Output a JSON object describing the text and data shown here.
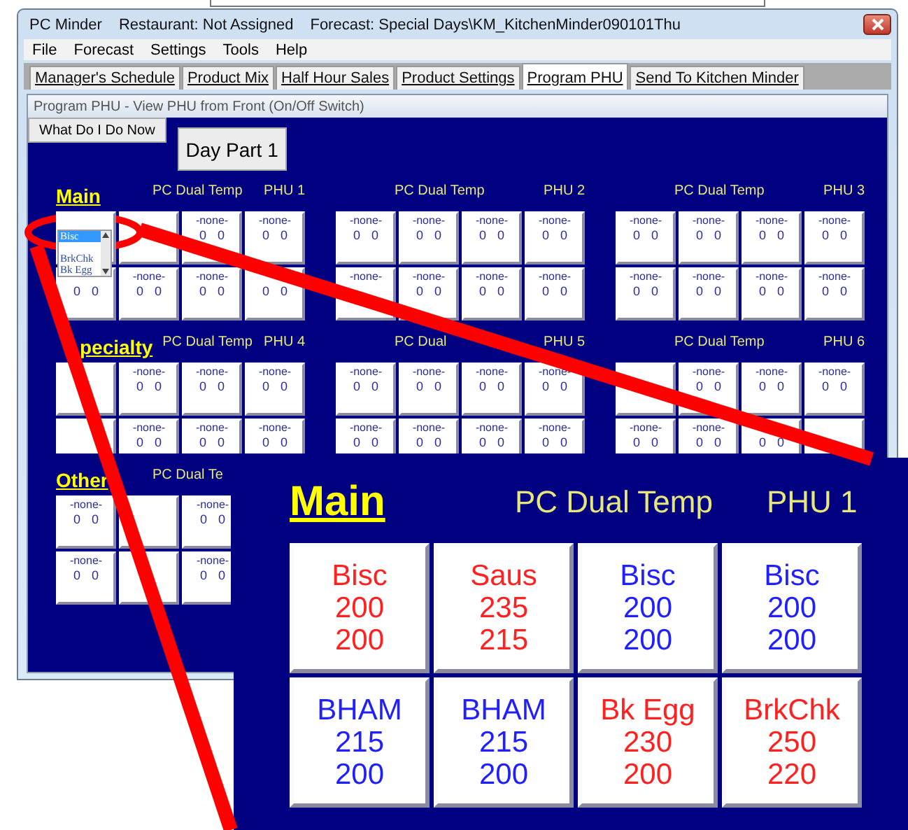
{
  "window": {
    "title_parts": [
      "PC Minder",
      "Restaurant: Not Assigned",
      "Forecast: Special Days\\KM_KitchenMinder090101Thu"
    ]
  },
  "menu": [
    "File",
    "Forecast",
    "Settings",
    "Tools",
    "Help"
  ],
  "tabs": [
    {
      "label": "Manager's Schedule",
      "selected": false
    },
    {
      "label": "Product Mix",
      "selected": false
    },
    {
      "label": "Half Hour Sales",
      "selected": false
    },
    {
      "label": "Product Settings",
      "selected": false
    },
    {
      "label": "Program PHU",
      "selected": true
    },
    {
      "label": "Send To Kitchen Minder",
      "selected": false
    }
  ],
  "panel": {
    "title": "Program PHU - View PHU from Front (On/Off Switch)",
    "help_button": "What Do I Do Now",
    "day_part_button": "Day Part 1"
  },
  "sections": [
    {
      "title": "Main",
      "groups": [
        {
          "model": "PC Dual Temp",
          "phu": "PHU 1",
          "cells": [
            {
              "list": [
                {
                  "label": "Bisc",
                  "selected": true
                },
                {
                  "selected": false
                },
                {
                  "label": "BrkChk",
                  "selected": false
                },
                {
                  "label": "Bk Egg",
                  "selected": false
                }
              ]
            },
            {},
            {
              "name": "-none-",
              "values": [
                "0",
                "0"
              ]
            },
            {
              "name": "-none-",
              "values": [
                "0",
                "0"
              ]
            },
            {
              "values": [
                "0",
                "0"
              ]
            },
            {
              "name": "-none-",
              "values": [
                "0",
                "0"
              ]
            },
            {
              "name": "-none-",
              "values": [
                "0",
                "0"
              ]
            },
            {
              "values": [
                "0",
                "0"
              ]
            }
          ]
        },
        {
          "model": "PC Dual Temp",
          "phu": "PHU 2",
          "cells": [
            {
              "name": "-none-",
              "values": [
                "0",
                "0"
              ]
            },
            {
              "name": "-none-",
              "values": [
                "0",
                "0"
              ]
            },
            {
              "name": "-none-",
              "values": [
                "0",
                "0"
              ]
            },
            {
              "name": "-none-",
              "values": [
                "0",
                "0"
              ]
            },
            {
              "name": "-none-"
            },
            {
              "name": "-none-",
              "values": [
                "0",
                "0"
              ]
            },
            {
              "name": "-none-",
              "values": [
                "0",
                "0"
              ]
            },
            {
              "name": "-none-",
              "values": [
                "0",
                "0"
              ]
            }
          ]
        },
        {
          "model": "PC Dual Temp",
          "phu": "PHU 3",
          "cells": [
            {
              "name": "-none-",
              "values": [
                "0",
                "0"
              ]
            },
            {
              "name": "-none-",
              "values": [
                "0",
                "0"
              ]
            },
            {
              "name": "-none-",
              "values": [
                "0",
                "0"
              ]
            },
            {
              "name": "-none-",
              "values": [
                "0",
                "0"
              ]
            },
            {
              "name": "-none-",
              "values": [
                "0",
                "0"
              ]
            },
            {
              "name": "-none-",
              "values": [
                "0",
                "0"
              ]
            },
            {
              "name": "-none-",
              "values": [
                "0",
                "0"
              ]
            },
            {
              "name": "-none-",
              "values": [
                "0",
                "0"
              ]
            }
          ]
        }
      ]
    },
    {
      "title": "pecialty",
      "groups": [
        {
          "model": "PC Dual Temp",
          "phu": "PHU 4",
          "cells": [
            {},
            {
              "name": "-none-",
              "values": [
                "0",
                "0"
              ]
            },
            {
              "name": "-none-",
              "values": [
                "0",
                "0"
              ]
            },
            {
              "name": "-none-",
              "values": [
                "0",
                "0"
              ]
            },
            {},
            {
              "name": "-none-",
              "values": [
                "0",
                "0"
              ]
            },
            {
              "name": "-none-",
              "values": [
                "0",
                "0"
              ]
            },
            {
              "name": "-none-",
              "values": [
                "0",
                "0"
              ]
            }
          ]
        },
        {
          "model": "PC Dual",
          "phu": "PHU 5",
          "cells": [
            {
              "name": "-none-",
              "values": [
                "0",
                "0"
              ]
            },
            {
              "name": "-none-",
              "values": [
                "0",
                "0"
              ]
            },
            {
              "name": "-none-",
              "values": [
                "0",
                "0"
              ]
            },
            {
              "name": "-none-",
              "values": [
                "0",
                "0"
              ]
            },
            {
              "name": "-none-",
              "values": [
                "0",
                "0"
              ]
            },
            {
              "name": "-none-",
              "values": [
                "0",
                "0"
              ]
            },
            {
              "name": "-none-",
              "values": [
                "0",
                "0"
              ]
            },
            {
              "name": "-none-",
              "values": [
                "0",
                "0"
              ]
            }
          ]
        },
        {
          "model": "PC Dual Temp",
          "phu": "PHU 6",
          "cells": [
            {},
            {
              "name": "-none-",
              "values": [
                "0",
                "0"
              ]
            },
            {
              "name": "-none-",
              "values": [
                "0",
                "0"
              ]
            },
            {
              "name": "-none-",
              "values": [
                "0",
                "0"
              ]
            },
            {
              "name": "-none-",
              "values": [
                "0",
                "0"
              ]
            },
            {
              "name": "-none-",
              "values": [
                "0",
                "0"
              ]
            },
            {
              "values": [
                "0",
                "0"
              ]
            },
            {}
          ]
        }
      ]
    },
    {
      "title": "Other",
      "groups": [
        {
          "model": "PC Dual Te",
          "cells": [
            {
              "name": "-none-",
              "values": [
                "0",
                "0"
              ]
            },
            {},
            {
              "name": "-none-",
              "values": [
                "0",
                "0"
              ]
            },
            {
              "name": "-none-",
              "values": [
                "0",
                "0"
              ]
            },
            {},
            {
              "name": "-none-",
              "values": [
                "0",
                "0"
              ]
            }
          ]
        }
      ]
    }
  ],
  "inset": {
    "title": "Main",
    "model": "PC Dual Temp",
    "phu": "PHU 1",
    "cells": [
      {
        "name": "Bisc",
        "values": [
          "200",
          "200"
        ],
        "color": "#ff2020"
      },
      {
        "name": "Saus",
        "values": [
          "235",
          "215"
        ],
        "color": "#ff2020"
      },
      {
        "name": "Bisc",
        "values": [
          "200",
          "200"
        ],
        "color": "#2020ff"
      },
      {
        "name": "Bisc",
        "values": [
          "200",
          "200"
        ],
        "color": "#2020ff"
      },
      {
        "name": "BHAM",
        "values": [
          "215",
          "200"
        ],
        "color": "#2020ff"
      },
      {
        "name": "BHAM",
        "values": [
          "215",
          "200"
        ],
        "color": "#2020ff"
      },
      {
        "name": "Bk Egg",
        "values": [
          "230",
          "200"
        ],
        "color": "#ff2020"
      },
      {
        "name": "BrkChk",
        "values": [
          "250",
          "220"
        ],
        "color": "#ff2020"
      }
    ]
  }
}
